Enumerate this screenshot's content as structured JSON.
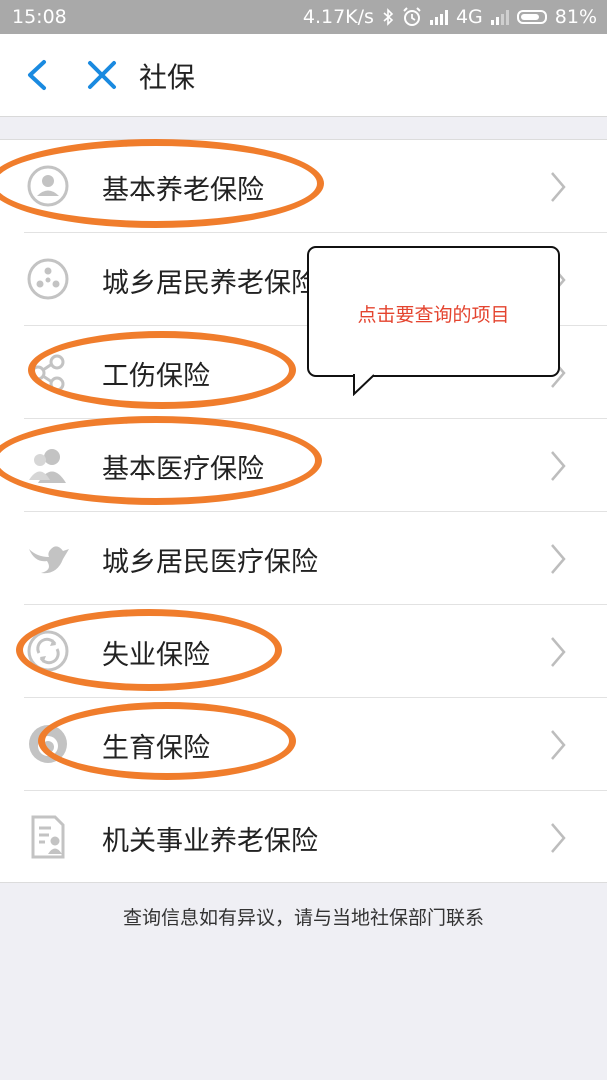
{
  "status_bar": {
    "time": "15:08",
    "network_speed": "4.17K/s",
    "network_type": "4G",
    "battery": "81%"
  },
  "nav": {
    "title": "社保",
    "back_icon": "chevron-left-icon",
    "close_icon": "close-icon",
    "accent_color": "#1a8ae0"
  },
  "items": [
    {
      "label": "基本养老保险",
      "icon": "person-circle-icon",
      "circled": true
    },
    {
      "label": "城乡居民养老保险",
      "icon": "nodes-circle-icon",
      "circled": false
    },
    {
      "label": "工伤保险",
      "icon": "share-icon",
      "circled": true
    },
    {
      "label": "基本医疗保险",
      "icon": "people-icon",
      "circled": true
    },
    {
      "label": "城乡居民医疗保险",
      "icon": "bird-icon",
      "circled": false
    },
    {
      "label": "失业保险",
      "icon": "refresh-circle-icon",
      "circled": true
    },
    {
      "label": "生育保险",
      "icon": "baby-circle-icon",
      "circled": true
    },
    {
      "label": "机关事业养老保险",
      "icon": "document-person-icon",
      "circled": false
    }
  ],
  "tooltip": {
    "text": "点击要查询的项目"
  },
  "footer": {
    "text": "查询信息如有异议，请与当地社保部门联系"
  },
  "annotation_color": "#f07d2c"
}
